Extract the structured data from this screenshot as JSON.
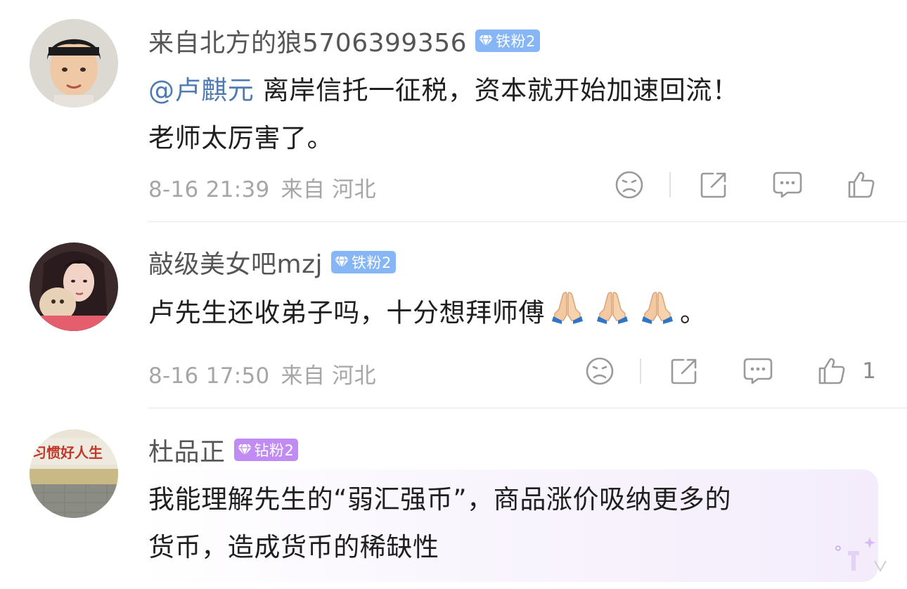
{
  "comments": [
    {
      "username": "来自北方的狼5706399356",
      "badge": "铁粉2",
      "mention": "@卢麒元",
      "line1": " 离岸信托一征税，资本就开始加速回流！",
      "line2": "老师太厉害了。",
      "date": "8-16 21:39",
      "source": "来自 河北",
      "like_count": ""
    },
    {
      "username": "敲级美女吧mzj",
      "badge": "铁粉2",
      "line1": "卢先生还收弟子吗，十分想拜师傅",
      "line1_suffix": "。",
      "date": "8-16 17:50",
      "source": "来自 河北",
      "like_count": "1"
    },
    {
      "username": "杜品正",
      "badge": "钻粉2",
      "line1": "我能理解先生的“弱汇强币”，商品涨价吸纳更多的",
      "line2": "货币，造成货币的稀缺性",
      "avatar_text": "习惯好人生"
    }
  ],
  "icons": [
    "dislike-icon",
    "share-icon",
    "comment-icon",
    "like-icon",
    "folded-hands-emoji",
    "iron-fan-diamond-icon"
  ],
  "colors": {
    "mention": "#4f7bb3",
    "badge_iron": "#86b6f5",
    "badge_diamond": "#c08cf3",
    "meta": "#a6a6a6",
    "icon": "#9a9a9a"
  }
}
